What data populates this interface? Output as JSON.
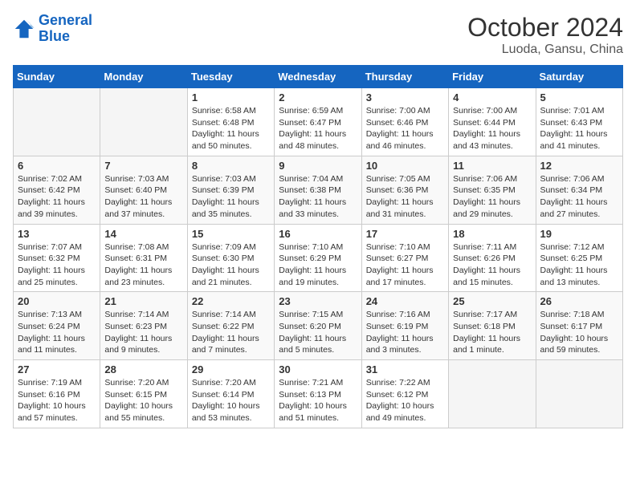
{
  "header": {
    "logo_line1": "General",
    "logo_line2": "Blue",
    "month": "October 2024",
    "location": "Luoda, Gansu, China"
  },
  "weekdays": [
    "Sunday",
    "Monday",
    "Tuesday",
    "Wednesday",
    "Thursday",
    "Friday",
    "Saturday"
  ],
  "rows": [
    [
      {
        "day": "",
        "empty": true
      },
      {
        "day": "",
        "empty": true
      },
      {
        "day": "1",
        "sunrise": "Sunrise: 6:58 AM",
        "sunset": "Sunset: 6:48 PM",
        "daylight": "Daylight: 11 hours and 50 minutes."
      },
      {
        "day": "2",
        "sunrise": "Sunrise: 6:59 AM",
        "sunset": "Sunset: 6:47 PM",
        "daylight": "Daylight: 11 hours and 48 minutes."
      },
      {
        "day": "3",
        "sunrise": "Sunrise: 7:00 AM",
        "sunset": "Sunset: 6:46 PM",
        "daylight": "Daylight: 11 hours and 46 minutes."
      },
      {
        "day": "4",
        "sunrise": "Sunrise: 7:00 AM",
        "sunset": "Sunset: 6:44 PM",
        "daylight": "Daylight: 11 hours and 43 minutes."
      },
      {
        "day": "5",
        "sunrise": "Sunrise: 7:01 AM",
        "sunset": "Sunset: 6:43 PM",
        "daylight": "Daylight: 11 hours and 41 minutes."
      }
    ],
    [
      {
        "day": "6",
        "sunrise": "Sunrise: 7:02 AM",
        "sunset": "Sunset: 6:42 PM",
        "daylight": "Daylight: 11 hours and 39 minutes."
      },
      {
        "day": "7",
        "sunrise": "Sunrise: 7:03 AM",
        "sunset": "Sunset: 6:40 PM",
        "daylight": "Daylight: 11 hours and 37 minutes."
      },
      {
        "day": "8",
        "sunrise": "Sunrise: 7:03 AM",
        "sunset": "Sunset: 6:39 PM",
        "daylight": "Daylight: 11 hours and 35 minutes."
      },
      {
        "day": "9",
        "sunrise": "Sunrise: 7:04 AM",
        "sunset": "Sunset: 6:38 PM",
        "daylight": "Daylight: 11 hours and 33 minutes."
      },
      {
        "day": "10",
        "sunrise": "Sunrise: 7:05 AM",
        "sunset": "Sunset: 6:36 PM",
        "daylight": "Daylight: 11 hours and 31 minutes."
      },
      {
        "day": "11",
        "sunrise": "Sunrise: 7:06 AM",
        "sunset": "Sunset: 6:35 PM",
        "daylight": "Daylight: 11 hours and 29 minutes."
      },
      {
        "day": "12",
        "sunrise": "Sunrise: 7:06 AM",
        "sunset": "Sunset: 6:34 PM",
        "daylight": "Daylight: 11 hours and 27 minutes."
      }
    ],
    [
      {
        "day": "13",
        "sunrise": "Sunrise: 7:07 AM",
        "sunset": "Sunset: 6:32 PM",
        "daylight": "Daylight: 11 hours and 25 minutes."
      },
      {
        "day": "14",
        "sunrise": "Sunrise: 7:08 AM",
        "sunset": "Sunset: 6:31 PM",
        "daylight": "Daylight: 11 hours and 23 minutes."
      },
      {
        "day": "15",
        "sunrise": "Sunrise: 7:09 AM",
        "sunset": "Sunset: 6:30 PM",
        "daylight": "Daylight: 11 hours and 21 minutes."
      },
      {
        "day": "16",
        "sunrise": "Sunrise: 7:10 AM",
        "sunset": "Sunset: 6:29 PM",
        "daylight": "Daylight: 11 hours and 19 minutes."
      },
      {
        "day": "17",
        "sunrise": "Sunrise: 7:10 AM",
        "sunset": "Sunset: 6:27 PM",
        "daylight": "Daylight: 11 hours and 17 minutes."
      },
      {
        "day": "18",
        "sunrise": "Sunrise: 7:11 AM",
        "sunset": "Sunset: 6:26 PM",
        "daylight": "Daylight: 11 hours and 15 minutes."
      },
      {
        "day": "19",
        "sunrise": "Sunrise: 7:12 AM",
        "sunset": "Sunset: 6:25 PM",
        "daylight": "Daylight: 11 hours and 13 minutes."
      }
    ],
    [
      {
        "day": "20",
        "sunrise": "Sunrise: 7:13 AM",
        "sunset": "Sunset: 6:24 PM",
        "daylight": "Daylight: 11 hours and 11 minutes."
      },
      {
        "day": "21",
        "sunrise": "Sunrise: 7:14 AM",
        "sunset": "Sunset: 6:23 PM",
        "daylight": "Daylight: 11 hours and 9 minutes."
      },
      {
        "day": "22",
        "sunrise": "Sunrise: 7:14 AM",
        "sunset": "Sunset: 6:22 PM",
        "daylight": "Daylight: 11 hours and 7 minutes."
      },
      {
        "day": "23",
        "sunrise": "Sunrise: 7:15 AM",
        "sunset": "Sunset: 6:20 PM",
        "daylight": "Daylight: 11 hours and 5 minutes."
      },
      {
        "day": "24",
        "sunrise": "Sunrise: 7:16 AM",
        "sunset": "Sunset: 6:19 PM",
        "daylight": "Daylight: 11 hours and 3 minutes."
      },
      {
        "day": "25",
        "sunrise": "Sunrise: 7:17 AM",
        "sunset": "Sunset: 6:18 PM",
        "daylight": "Daylight: 11 hours and 1 minute."
      },
      {
        "day": "26",
        "sunrise": "Sunrise: 7:18 AM",
        "sunset": "Sunset: 6:17 PM",
        "daylight": "Daylight: 10 hours and 59 minutes."
      }
    ],
    [
      {
        "day": "27",
        "sunrise": "Sunrise: 7:19 AM",
        "sunset": "Sunset: 6:16 PM",
        "daylight": "Daylight: 10 hours and 57 minutes."
      },
      {
        "day": "28",
        "sunrise": "Sunrise: 7:20 AM",
        "sunset": "Sunset: 6:15 PM",
        "daylight": "Daylight: 10 hours and 55 minutes."
      },
      {
        "day": "29",
        "sunrise": "Sunrise: 7:20 AM",
        "sunset": "Sunset: 6:14 PM",
        "daylight": "Daylight: 10 hours and 53 minutes."
      },
      {
        "day": "30",
        "sunrise": "Sunrise: 7:21 AM",
        "sunset": "Sunset: 6:13 PM",
        "daylight": "Daylight: 10 hours and 51 minutes."
      },
      {
        "day": "31",
        "sunrise": "Sunrise: 7:22 AM",
        "sunset": "Sunset: 6:12 PM",
        "daylight": "Daylight: 10 hours and 49 minutes."
      },
      {
        "day": "",
        "empty": true
      },
      {
        "day": "",
        "empty": true
      }
    ]
  ]
}
